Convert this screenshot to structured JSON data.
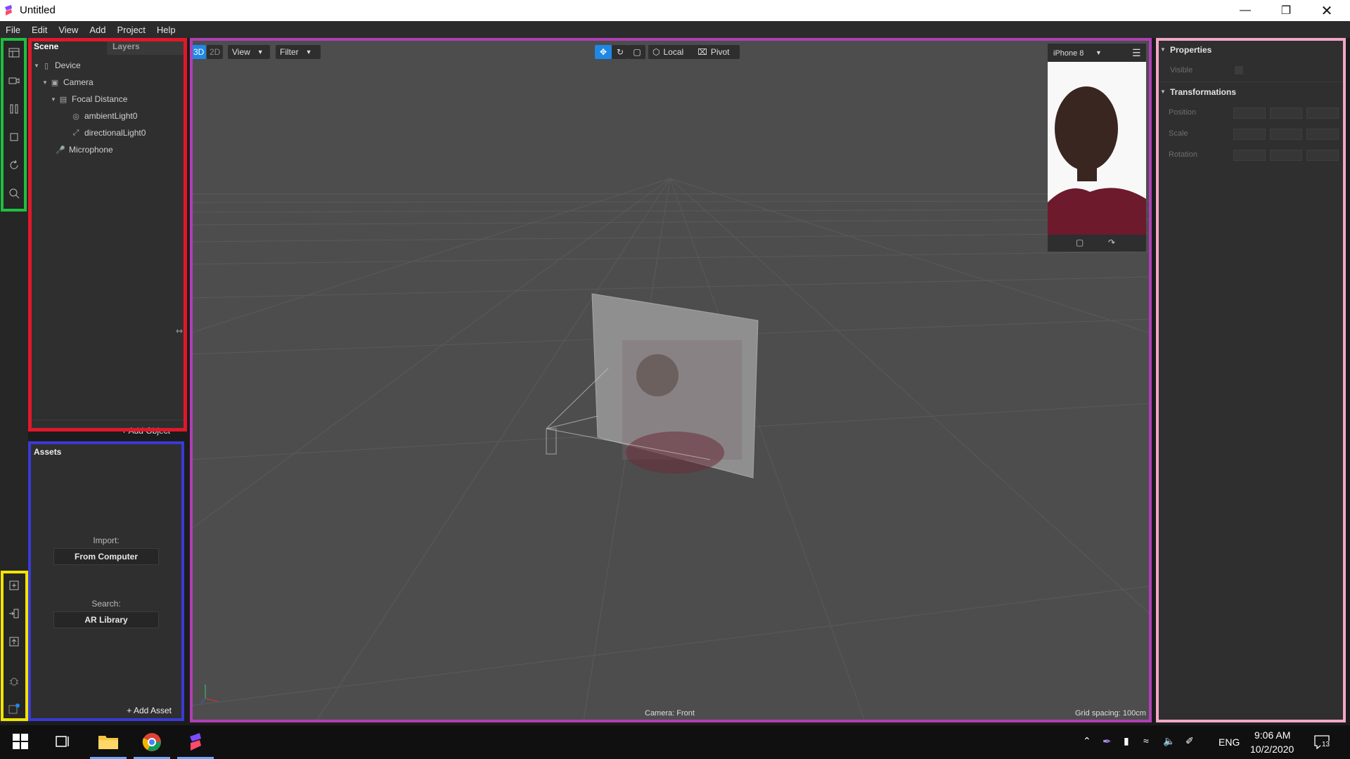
{
  "window": {
    "title": "Untitled"
  },
  "menu": [
    "File",
    "Edit",
    "View",
    "Add",
    "Project",
    "Help"
  ],
  "scene": {
    "tabs": [
      "Scene",
      "Layers"
    ],
    "tree": [
      {
        "label": "Device",
        "icon": "device-icon",
        "depth": 0,
        "expanded": true
      },
      {
        "label": "Camera",
        "icon": "camera-icon",
        "depth": 1,
        "expanded": true
      },
      {
        "label": "Focal Distance",
        "icon": "focal-distance-icon",
        "depth": 2,
        "expanded": true
      },
      {
        "label": "ambientLight0",
        "icon": "ambient-light-icon",
        "depth": 3
      },
      {
        "label": "directionalLight0",
        "icon": "directional-light-icon",
        "depth": 3
      },
      {
        "label": "Microphone",
        "icon": "microphone-icon",
        "depth": 1
      }
    ],
    "add_object": "+ Add Object"
  },
  "assets": {
    "title": "Assets",
    "import_label": "Import:",
    "import_button": "From Computer",
    "search_label": "Search:",
    "search_button": "AR Library",
    "add_asset": "+ Add Asset"
  },
  "viewport": {
    "mode_3d": "3D",
    "mode_2d": "2D",
    "view": "View",
    "filter": "Filter",
    "local": "Local",
    "pivot": "Pivot",
    "device": "iPhone 8",
    "camera_label": "Camera: Front",
    "grid_spacing": "Grid spacing: 100cm"
  },
  "properties": {
    "title": "Properties",
    "visible": "Visible",
    "transformations": "Transformations",
    "rows": [
      "Position",
      "Scale",
      "Rotation"
    ]
  },
  "taskbar": {
    "language": "ENG",
    "time": "9:06 AM",
    "date": "10/2/2020",
    "notifications": "13"
  },
  "colors": {
    "accent": "#1e88e5",
    "frame_green": "#1fbf3f",
    "frame_red": "#e0182a",
    "frame_blue": "#3a3ad6",
    "frame_yellow": "#f2e400",
    "frame_purple": "#b03fb5",
    "frame_pink": "#f2a7c6"
  }
}
